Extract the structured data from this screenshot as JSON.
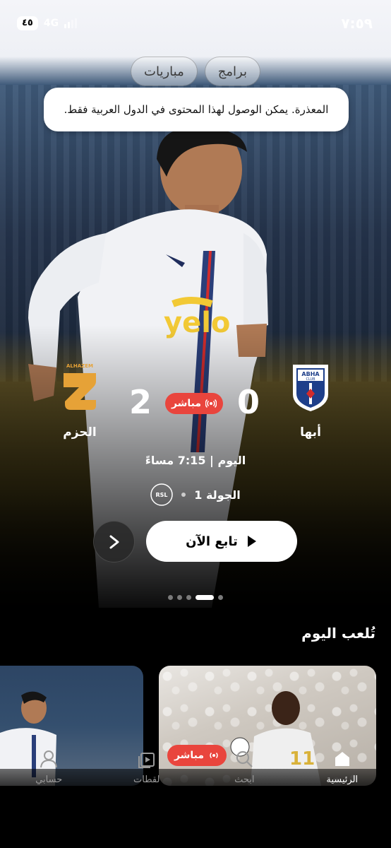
{
  "status_bar": {
    "time": "٧:٥٩",
    "network": "4G",
    "battery": "٤٥"
  },
  "top_tabs": [
    {
      "label": "برامج"
    },
    {
      "label": "مباريات"
    }
  ],
  "toast": {
    "message": "المعذرة. يمكن الوصول لهذا المحتوى في الدول العربية فقط."
  },
  "match": {
    "home_team": {
      "name": "أبها",
      "score": "0",
      "logo": "abha-club-logo"
    },
    "away_team": {
      "name": "الحزم",
      "score": "2",
      "logo": "alhazem-logo",
      "logo_text": "ALHAZEM"
    },
    "live_label": "مباشر",
    "time_text": "اليوم | 7:15 مساءً",
    "round": "الجولة 1",
    "league_logo": "rsl-logo"
  },
  "actions": {
    "watch_now": "تابع الآن",
    "next_icon": "chevron-right-icon"
  },
  "carousel": {
    "count": 5,
    "active": 3
  },
  "section": {
    "title": "تُلعب اليوم",
    "cards": [
      {
        "live_label": "مباشر"
      },
      {
        "live_label": ""
      }
    ]
  },
  "bottom_nav": [
    {
      "label": "الرئيسية",
      "icon": "home-icon",
      "active": true
    },
    {
      "label": "ابحث",
      "icon": "search-icon",
      "active": false
    },
    {
      "label": "لقطات",
      "icon": "clips-icon",
      "active": false
    },
    {
      "label": "حسابي",
      "icon": "user-icon",
      "active": false
    }
  ],
  "colors": {
    "live_red": "#e9453d",
    "background": "#000000"
  }
}
